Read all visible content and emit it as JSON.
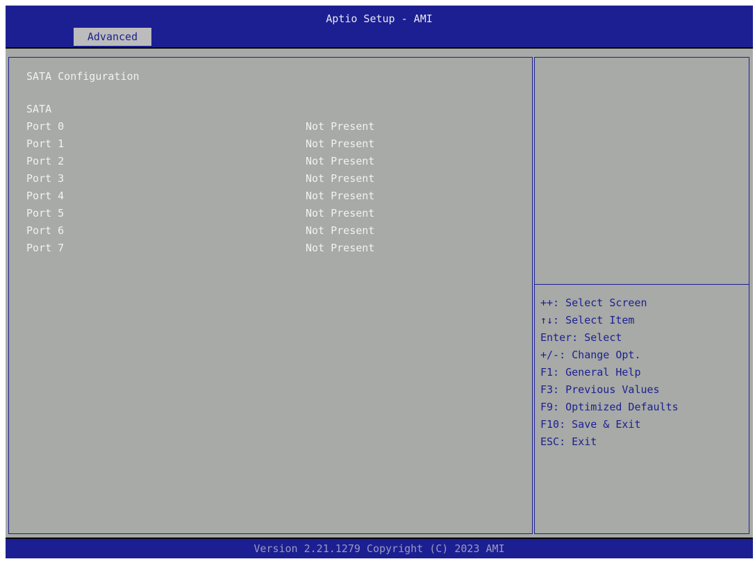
{
  "header": {
    "title": "Aptio Setup - AMI",
    "tab": "Advanced"
  },
  "main": {
    "section_title": "SATA Configuration",
    "group_label": "SATA",
    "ports": [
      {
        "label": "Port 0",
        "value": "Not Present"
      },
      {
        "label": "Port 1",
        "value": "Not Present"
      },
      {
        "label": "Port 2",
        "value": "Not Present"
      },
      {
        "label": "Port 3",
        "value": "Not Present"
      },
      {
        "label": "Port 4",
        "value": "Not Present"
      },
      {
        "label": "Port 5",
        "value": "Not Present"
      },
      {
        "label": "Port 6",
        "value": "Not Present"
      },
      {
        "label": "Port 7",
        "value": "Not Present"
      }
    ]
  },
  "help": {
    "keys": [
      "++: Select Screen",
      "↑↓: Select Item",
      "Enter: Select",
      "+/-: Change Opt.",
      "F1: General Help",
      "F3: Previous Values",
      "F9: Optimized Defaults",
      "F10: Save & Exit",
      "ESC: Exit"
    ]
  },
  "footer": {
    "version": "Version 2.21.1279 Copyright (C) 2023 AMI"
  },
  "colors": {
    "header_blue": "#1c1f91",
    "panel_gray": "#a7aaa6",
    "text_light": "#f2f2f2",
    "tab_gray": "#bcbcbc"
  }
}
